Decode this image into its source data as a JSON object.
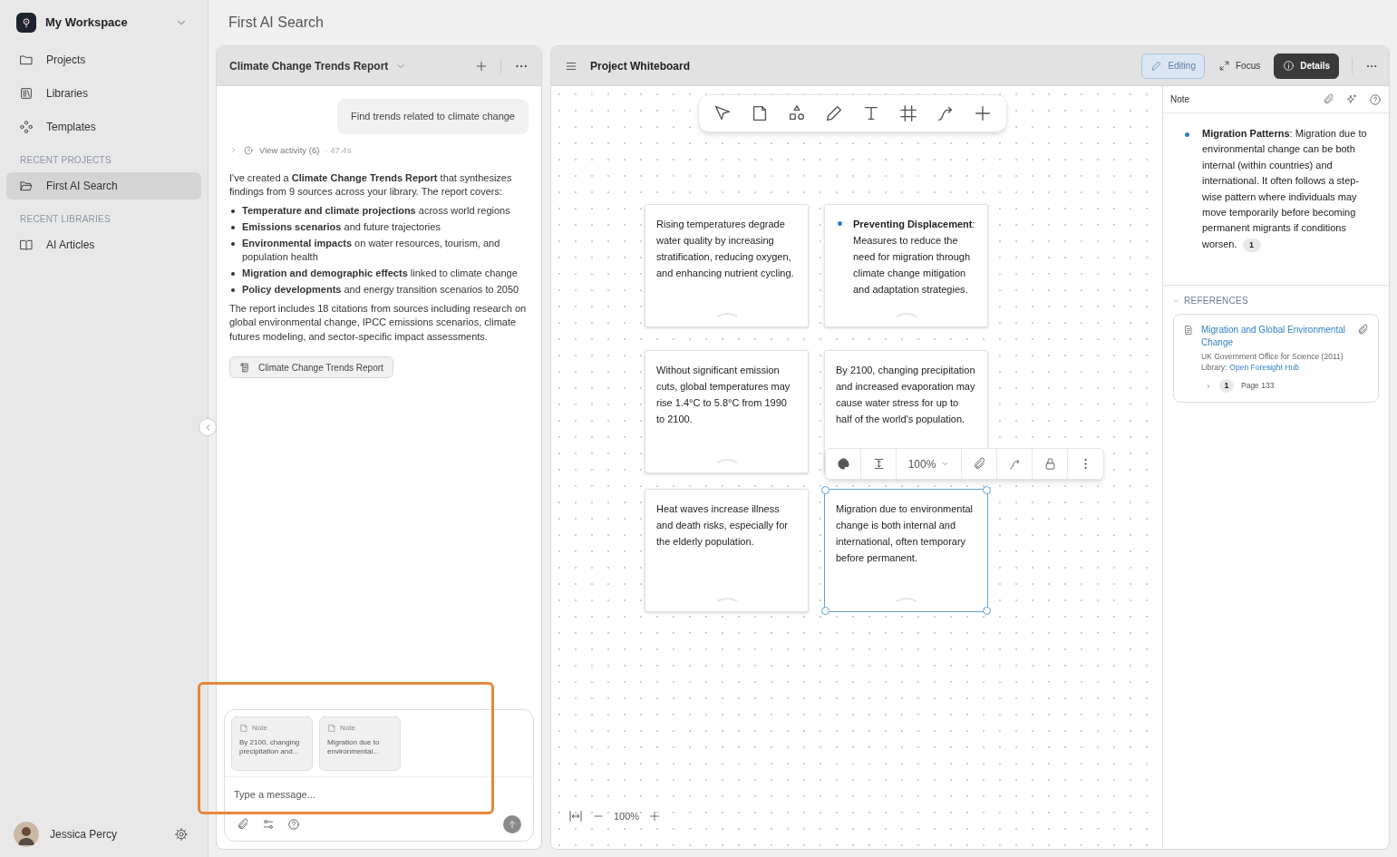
{
  "sidebar": {
    "workspace": "My Workspace",
    "nav": [
      {
        "label": "Projects",
        "selected": false
      },
      {
        "label": "Libraries",
        "selected": false
      },
      {
        "label": "Templates",
        "selected": false
      }
    ],
    "sections": [
      {
        "heading": "RECENT PROJECTS",
        "items": [
          {
            "label": "First AI Search",
            "selected": true
          }
        ]
      },
      {
        "heading": "RECENT LIBRARIES",
        "items": [
          {
            "label": "AI Articles",
            "selected": false
          }
        ]
      }
    ],
    "user": "Jessica Percy"
  },
  "page_title": "First AI Search",
  "chat": {
    "title": "Climate Change Trends Report",
    "user_message": "Find trends related to climate change",
    "activity": {
      "label": "View activity (6)",
      "time": "· 47.4s",
      "expanded": false
    },
    "intro": "I've created a **Climate Change Trends Report** that synthesizes findings from 9 sources across your library. The report covers:",
    "bullets": [
      "**Temperature and climate projections** across world regions",
      "**Emissions scenarios** and future trajectories",
      "**Environmental impacts** on water resources, tourism, and population health",
      "**Migration and demographic effects** linked to climate change",
      "**Policy developments** and energy transition scenarios to 2050"
    ],
    "outro": "The report includes 18 citations from sources including research on global environmental change, IPCC emissions scenarios, climate futures modeling, and sector-specific impact assessments.",
    "attachment": "Climate Change Trends Report",
    "context_chips": [
      {
        "label": "Note",
        "text": "By 2100, changing precipitation and..."
      },
      {
        "label": "Note",
        "text": "Migration due to environmental..."
      }
    ],
    "placeholder": "Type a message..."
  },
  "whiteboard": {
    "title": "Project Whiteboard",
    "modes": [
      {
        "kind": "mode",
        "label": "Editing",
        "selected": true
      },
      {
        "kind": "mode",
        "label": "Focus",
        "selected": false
      },
      {
        "kind": "toggle",
        "label": "Details",
        "on": true
      }
    ],
    "notes": [
      {
        "kind": "plain",
        "text": "Rising temperatures degrade water quality by increasing stratification, reducing oxygen, and enhancing nutrient cycling.",
        "selected": false
      },
      {
        "kind": "bullet",
        "text": "**Preventing Displacement**: Measures to reduce the need for migration through climate change mitigation and adaptation strategies.",
        "selected": false
      },
      {
        "kind": "plain",
        "text": "Without significant emission cuts, global temperatures may rise 1.4°C to 5.8°C from 1990 to 2100.",
        "selected": false
      },
      {
        "kind": "plain",
        "text": "By 2100, changing precipitation and increased evaporation may cause water stress for up to half of the world's population.",
        "selected": false
      },
      {
        "kind": "plain",
        "text": "Heat waves increase illness and death risks, especially for the elderly population.",
        "selected": false
      },
      {
        "kind": "plain",
        "text": "Migration due to environmental change is both internal and international, often temporary before permanent.",
        "selected": true
      }
    ],
    "note_zoom": "100%",
    "zoom": "100%"
  },
  "details": {
    "header": "Note",
    "note": "**Migration Patterns**: Migration due to environmental change can be both internal (within countries) and international. It often follows a step-wise pattern where individuals may move temporarily before becoming permanent migrants if conditions worsen.",
    "citation": "1",
    "references_heading": "REFERENCES",
    "references": [
      {
        "title": "Migration and Global Environmental Change",
        "source": "UK Government Office for Science (2011)",
        "library_label": "Library:",
        "library": "Open Foresight Hub",
        "count": "1",
        "page": "Page 133"
      }
    ]
  }
}
